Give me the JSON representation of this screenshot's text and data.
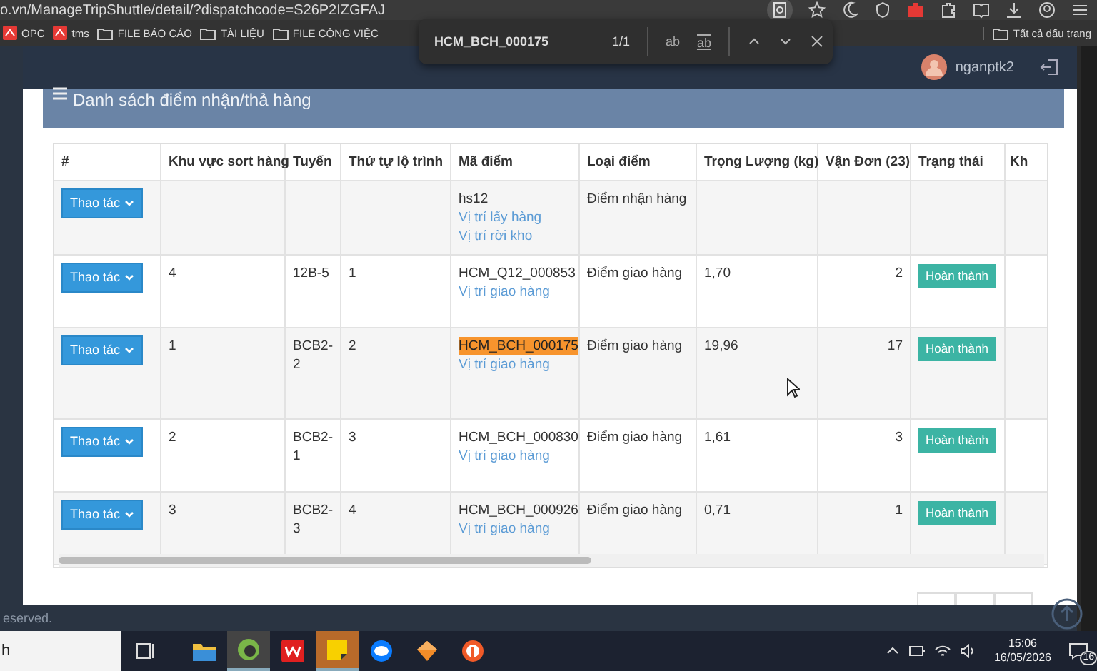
{
  "browser": {
    "url": "o.vn/ManageTripShuttle/detail/?dispatchcode=S26P2IZGFAJ",
    "bookmarks": [
      {
        "label": "OPC",
        "kind": "site"
      },
      {
        "label": "tms",
        "kind": "site"
      },
      {
        "label": "FILE BÁO CÁO",
        "kind": "folder"
      },
      {
        "label": "TÀI LIỆU",
        "kind": "folder"
      },
      {
        "label": "FILE CÔNG VIỆC",
        "kind": "folder"
      }
    ],
    "all_bookmarks": "Tất cả dấu trang"
  },
  "find_bar": {
    "query": "HCM_BCH_000175",
    "count": "1/1",
    "options": [
      {
        "label": "ab",
        "kind": "case"
      },
      {
        "label": "ab",
        "kind": "word"
      }
    ]
  },
  "header": {
    "user": "nganptk2"
  },
  "panel": {
    "title": "Danh sách điểm nhận/thả hàng"
  },
  "table": {
    "columns": [
      "#",
      "Khu vực sort hàng",
      "Tuyến",
      "Thứ tự lộ trình",
      "Mã điểm",
      "Loại điểm",
      "Trọng Lượng (kg)",
      "Vận Đơn (23)",
      "Trạng thái",
      "Kh"
    ],
    "rows": [
      {
        "action": "Thao tác",
        "code": "hs12",
        "code_highlighted": false,
        "links": [
          "Vị trí lấy hàng",
          "Vị trí rời kho"
        ],
        "point_type": "Điểm nhận hàng"
      },
      {
        "action": "Thao tác",
        "sort_area": "4",
        "route": "12B-5",
        "order": "1",
        "code": "HCM_Q12_000853",
        "code_highlighted": false,
        "links": [
          "Vị trí giao hàng"
        ],
        "point_type": "Điểm giao hàng",
        "weight": "1,70",
        "waybills": "2",
        "status": "Hoàn thành"
      },
      {
        "action": "Thao tác",
        "sort_area": "1",
        "route": "BCB2-2",
        "order": "2",
        "code": "HCM_BCH_000175",
        "code_highlighted": true,
        "links": [
          "Vị trí giao hàng"
        ],
        "point_type": "Điểm giao hàng",
        "weight": "19,96",
        "waybills": "17",
        "status": "Hoàn thành"
      },
      {
        "action": "Thao tác",
        "sort_area": "2",
        "route": "BCB2-1",
        "order": "3",
        "code": "HCM_BCH_000830",
        "code_highlighted": false,
        "links": [
          "Vị trí giao hàng"
        ],
        "point_type": "Điểm giao hàng",
        "weight": "1,61",
        "waybills": "3",
        "status": "Hoàn thành"
      },
      {
        "action": "Thao tác",
        "sort_area": "3",
        "route": "BCB2-3",
        "order": "4",
        "code": "HCM_BCH_000926",
        "code_highlighted": false,
        "links": [
          "Vị trí giao hàng"
        ],
        "point_type": "Điểm giao hàng",
        "weight": "0,71",
        "waybills": "1",
        "status": "Hoàn thành"
      }
    ]
  },
  "footer": {
    "text": "eserved."
  },
  "taskbar": {
    "search": "h",
    "time": "15:06",
    "date": "16/05/2026",
    "notifications": "16"
  }
}
